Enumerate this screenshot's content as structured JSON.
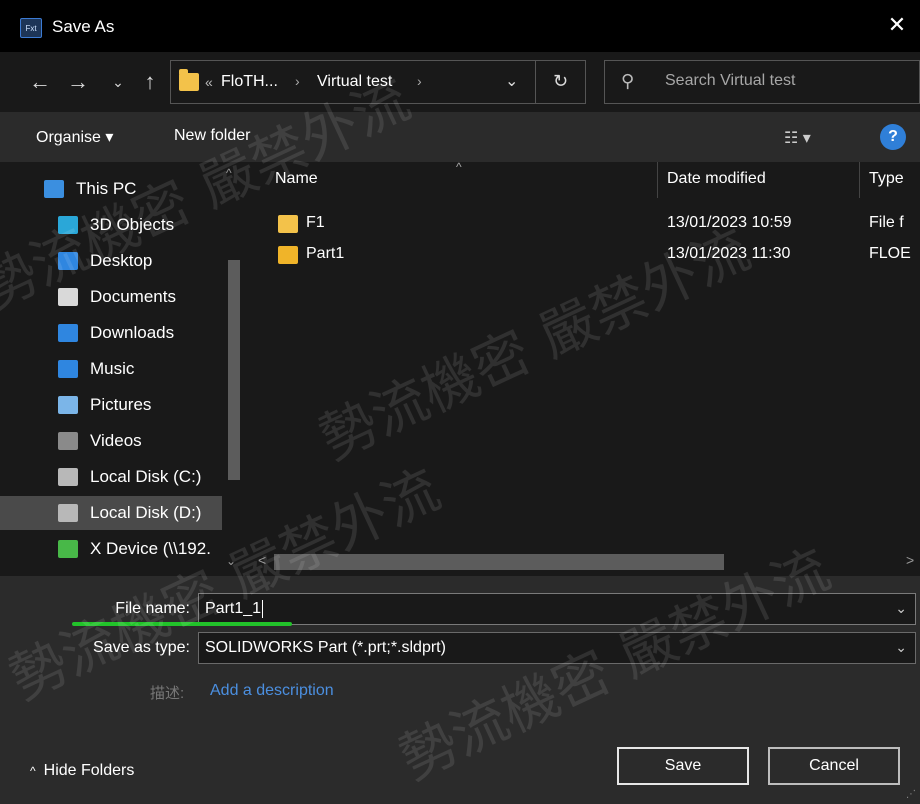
{
  "window": {
    "title": "Save As",
    "app_icon_text": "Fxt",
    "close_glyph": "✕"
  },
  "nav": {
    "back_glyph": "←",
    "forward_glyph": "→",
    "recent_glyph": "⌄",
    "up_glyph": "↑",
    "breadcrumb_overflow": "«",
    "breadcrumbs": [
      "FloTH...",
      "Virtual test"
    ],
    "breadcrumb_sep": "›",
    "dropdown_glyph": "⌄",
    "refresh_glyph": "↻",
    "search_placeholder": "Search Virtual test",
    "search_glyph": "⚲"
  },
  "toolbar": {
    "organise_label": "Organise ▾",
    "new_folder_label": "New folder",
    "view_glyph": "☷ ▾",
    "help_glyph": "?"
  },
  "sidebar": {
    "items": [
      {
        "label": "This PC",
        "icon": "this-pc-icon",
        "color": "#3b8fe0"
      },
      {
        "label": "3D Objects",
        "icon": "3d-objects-icon",
        "color": "#2aa7d8"
      },
      {
        "label": "Desktop",
        "icon": "desktop-icon",
        "color": "#2f86e0"
      },
      {
        "label": "Documents",
        "icon": "documents-icon",
        "color": "#d9d9d9"
      },
      {
        "label": "Downloads",
        "icon": "downloads-icon",
        "color": "#2f86e0"
      },
      {
        "label": "Music",
        "icon": "music-icon",
        "color": "#2f86e0"
      },
      {
        "label": "Pictures",
        "icon": "pictures-icon",
        "color": "#7bb5e8"
      },
      {
        "label": "Videos",
        "icon": "videos-icon",
        "color": "#8a8a8a"
      },
      {
        "label": "Local Disk (C:)",
        "icon": "local-disk-c-icon",
        "color": "#b8b8b8"
      },
      {
        "label": "Local Disk (D:)",
        "icon": "local-disk-d-icon",
        "color": "#b8b8b8"
      },
      {
        "label": "X Device (\\\\192.",
        "icon": "network-drive-icon",
        "color": "#48b848"
      }
    ],
    "selected_index": 9,
    "scroll_up": "^",
    "scroll_down": "⌄"
  },
  "columns": {
    "name": "Name",
    "date": "Date modified",
    "type": "Type",
    "sort_glyph": "^"
  },
  "files": [
    {
      "name": "F1",
      "date": "13/01/2023 10:59",
      "type": "File f",
      "icon": "folder-icon",
      "color": "#f3c24a"
    },
    {
      "name": "Part1",
      "date": "13/01/2023 11:30",
      "type": "FLOE",
      "icon": "solidworks-part-icon",
      "color": "#f0b429"
    }
  ],
  "hscroll": {
    "left": "<",
    "right": ">"
  },
  "form": {
    "file_name_label": "File name:",
    "file_name_value": "Part1_1",
    "save_type_label": "Save as type:",
    "save_type_value": "SOLIDWORKS Part (*.prt;*.sldprt)",
    "drop_glyph": "⌄",
    "desc_label": "描述:",
    "desc_link": "Add a description"
  },
  "footer": {
    "hide_folders_label": "Hide Folders",
    "hide_folders_glyph": "^",
    "save_label": "Save",
    "cancel_label": "Cancel"
  },
  "watermark_text": "勢流機密 嚴禁外流"
}
